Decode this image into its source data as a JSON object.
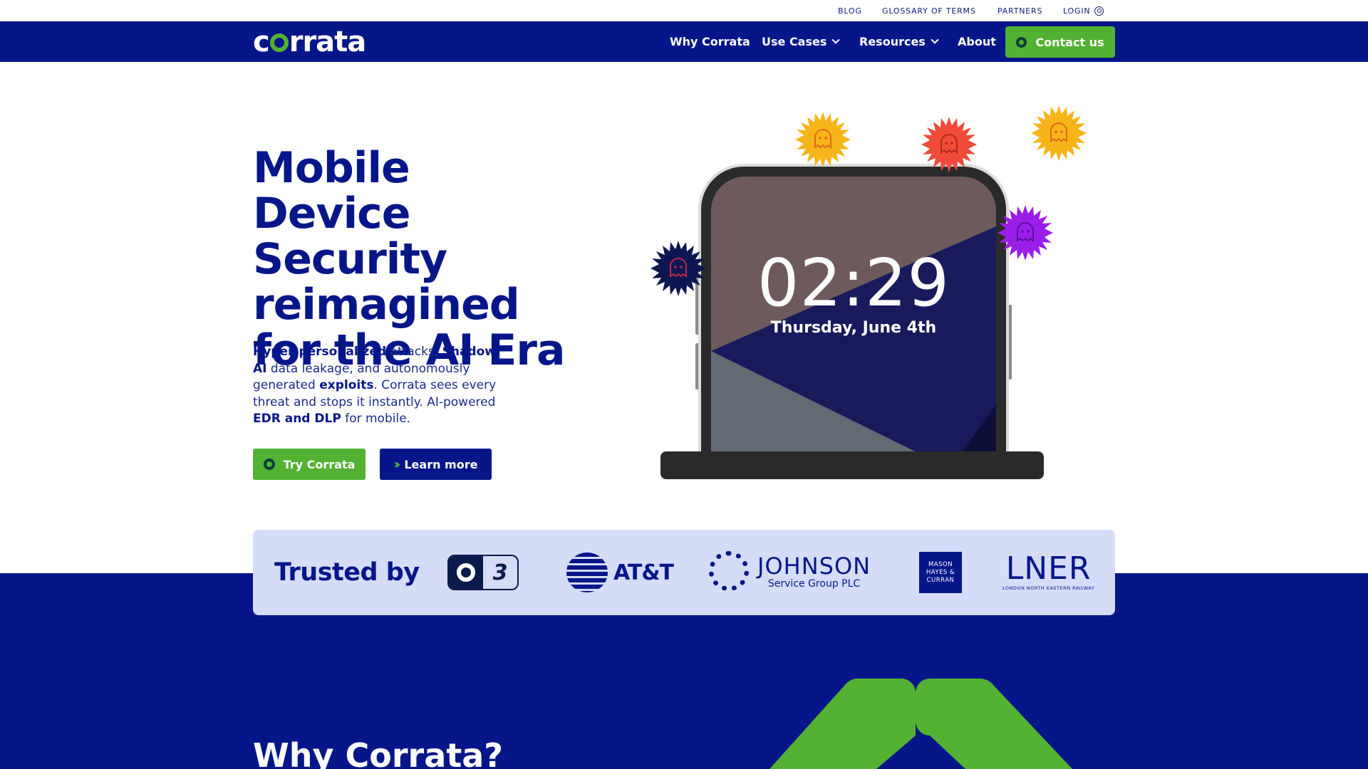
{
  "utility_nav": {
    "blog": "BLOG",
    "glossary": "GLOSSARY OF TERMS",
    "partners": "PARTNERS",
    "login": "LOGIN"
  },
  "main_nav": {
    "logo": "corrata",
    "items": [
      "Why Corrata",
      "Use Cases",
      "Resources",
      "About"
    ],
    "contact": "Contact us"
  },
  "hero": {
    "title_lines": [
      "Mobile Device",
      "Security",
      "reimagined",
      "for the AI Era"
    ],
    "desc": {
      "p1": "Hyper-personalized",
      "p2": " attacks, ",
      "p3": "Shadow AI",
      "p4": " data leakage, and autonomously generated ",
      "p5": "exploits",
      "p6": ". Corrata sees every threat and stops it instantly. AI-powered ",
      "p7": "EDR and DLP",
      "p8": " for mobile."
    },
    "try_button": "Try Corrata",
    "learn_button": "Learn more"
  },
  "phone": {
    "time": "02:29",
    "date": "Thursday, June 4th"
  },
  "trusted": {
    "label": "Trusted by",
    "att": "AT&T",
    "three_symbol": "3",
    "johnson_main": "JOHNSON",
    "johnson_sub": "Service Group PLC",
    "mason": [
      "MASON",
      "HAYES &",
      "CURRAN"
    ],
    "lner_main": "LNER",
    "lner_sub": "LONDON NORTH EASTERN RAILWAY"
  },
  "why": {
    "title": "Why Corrata?"
  },
  "colors": {
    "navy": "#061689",
    "green": "#53b233",
    "trusted_bg": "#d4dcf7"
  }
}
